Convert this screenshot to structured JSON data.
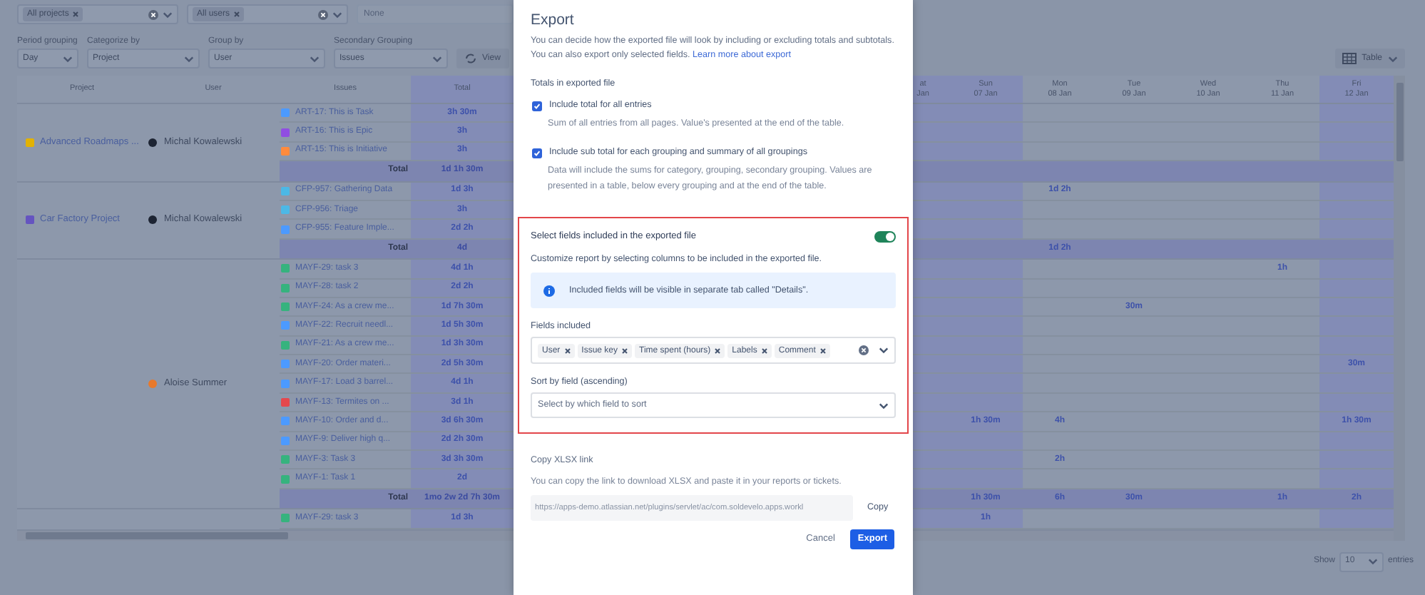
{
  "filters": {
    "projects": {
      "tags": [
        "All projects"
      ]
    },
    "users": {
      "tags": [
        "All users"
      ]
    },
    "third": {
      "placeholder": "None"
    }
  },
  "grouping": [
    {
      "label": "Period grouping",
      "value": "Day"
    },
    {
      "label": "Categorize by",
      "value": "Project"
    },
    {
      "label": "Group by",
      "value": "User"
    },
    {
      "label": "Secondary Grouping",
      "value": "Issues"
    }
  ],
  "view_button": "View",
  "table_button": "Table",
  "table": {
    "columns": [
      "Project",
      "User",
      "Issues",
      "Total"
    ],
    "day_columns": [
      {
        "day": "at",
        "date": "Jan"
      },
      {
        "day": "Sun",
        "date": "07 Jan"
      },
      {
        "day": "Mon",
        "date": "08 Jan"
      },
      {
        "day": "Tue",
        "date": "09 Jan"
      },
      {
        "day": "Wed",
        "date": "10 Jan"
      },
      {
        "day": "Thu",
        "date": "11 Jan"
      },
      {
        "day": "Fri",
        "date": "12 Jan"
      }
    ],
    "groups": [
      {
        "project": {
          "name": "Advanced Roadmaps ...",
          "color": "#e2b203"
        },
        "user": {
          "name": "Michal Kowalewski",
          "color": "#1d2433"
        },
        "rows": [
          {
            "issue": "ART-17: This is Task",
            "color": "#4c9aff",
            "total": "3h 30m"
          },
          {
            "issue": "ART-16: This is Epic",
            "color": "#904ee2",
            "total": "3h"
          },
          {
            "issue": "ART-15: This is Initiative",
            "color": "#ff8b3d",
            "total": "3h"
          }
        ],
        "summary": {
          "label": "Total",
          "total": "1d 1h 30m"
        }
      },
      {
        "project": {
          "name": "Car Factory Project",
          "color": "#6554c0"
        },
        "user": {
          "name": "Michal Kowalewski",
          "color": "#1d2433"
        },
        "rows": [
          {
            "issue": "CFP-957: Gathering Data",
            "color": "#4cb8e6",
            "total": "1d 3h",
            "days": [
              {
                "kind": "empty"
              },
              {
                "kind": "empty"
              },
              {
                "kind": "time",
                "text": "1d 2h"
              },
              {
                "kind": "empty"
              },
              {
                "kind": "empty"
              },
              {
                "kind": "empty"
              },
              {
                "kind": "empty"
              }
            ]
          },
          {
            "issue": "CFP-956: Triage",
            "color": "#4cb8e6",
            "total": "3h"
          },
          {
            "issue": "CFP-955: Feature Imple...",
            "color": "#4c9aff",
            "total": "2d 2h"
          }
        ],
        "summary": {
          "label": "Total",
          "total": "4d",
          "days": [
            {
              "kind": "empty"
            },
            {
              "kind": "empty"
            },
            {
              "kind": "time",
              "text": "1d 2h"
            },
            {
              "kind": "empty"
            },
            {
              "kind": "empty"
            },
            {
              "kind": "empty"
            },
            {
              "kind": "empty"
            }
          ]
        }
      },
      {
        "user": {
          "name": "Aloise Summer",
          "color": "#e8792b"
        },
        "rows": [
          {
            "issue": "MAYF-29: task 3",
            "color": "#36b37e",
            "total": "4d 1h",
            "days": [
              {
                "kind": "empty"
              },
              {
                "kind": "empty"
              },
              {
                "kind": "empty"
              },
              {
                "kind": "empty"
              },
              {
                "kind": "empty"
              },
              {
                "kind": "time",
                "text": "1h"
              },
              {
                "kind": "empty"
              }
            ]
          },
          {
            "issue": "MAYF-28: task 2",
            "color": "#36b37e",
            "total": "2d 2h"
          },
          {
            "issue": "MAYF-24: As a crew me...",
            "color": "#36b37e",
            "total": "1d 7h 30m",
            "days": [
              {
                "kind": "empty"
              },
              {
                "kind": "empty"
              },
              {
                "kind": "empty"
              },
              {
                "kind": "time",
                "text": "30m"
              },
              {
                "kind": "empty"
              },
              {
                "kind": "empty"
              },
              {
                "kind": "empty"
              }
            ]
          },
          {
            "issue": "MAYF-22: Recruit needl...",
            "color": "#4c9aff",
            "total": "1d 5h 30m"
          },
          {
            "issue": "MAYF-21: As a crew me...",
            "color": "#36b37e",
            "total": "1d 3h 30m"
          },
          {
            "issue": "MAYF-20: Order materi...",
            "color": "#4c9aff",
            "total": "2d 5h 30m",
            "days": [
              {
                "kind": "empty"
              },
              {
                "kind": "empty"
              },
              {
                "kind": "empty"
              },
              {
                "kind": "empty"
              },
              {
                "kind": "empty"
              },
              {
                "kind": "empty"
              },
              {
                "kind": "time",
                "text": "30m"
              }
            ]
          },
          {
            "issue": "MAYF-17: Load 3 barrel...",
            "color": "#4c9aff",
            "total": "4d 1h"
          },
          {
            "issue": "MAYF-13: Termites on ...",
            "color": "#e5484d",
            "total": "3d 1h"
          },
          {
            "issue": "MAYF-10: Order and d...",
            "color": "#4c9aff",
            "total": "3d 6h 30m",
            "days": [
              {
                "kind": "empty"
              },
              {
                "kind": "time",
                "text": "1h 30m"
              },
              {
                "kind": "time",
                "text": "4h"
              },
              {
                "kind": "empty"
              },
              {
                "kind": "empty"
              },
              {
                "kind": "empty"
              },
              {
                "kind": "time",
                "text": "1h 30m"
              }
            ]
          },
          {
            "issue": "MAYF-9: Deliver high q...",
            "color": "#4c9aff",
            "total": "2d 2h 30m"
          },
          {
            "issue": "MAYF-3: Task 3",
            "color": "#36b37e",
            "total": "3d 3h 30m",
            "days": [
              {
                "kind": "empty"
              },
              {
                "kind": "empty"
              },
              {
                "kind": "time",
                "text": "2h"
              },
              {
                "kind": "empty"
              },
              {
                "kind": "empty"
              },
              {
                "kind": "empty"
              },
              {
                "kind": "empty"
              }
            ]
          },
          {
            "issue": "MAYF-1: Task 1",
            "color": "#36b37e",
            "total": "2d"
          }
        ],
        "summary": {
          "label": "Total",
          "total": "1mo 2w 2d 7h 30m",
          "days": [
            {
              "kind": "empty"
            },
            {
              "kind": "time",
              "text": "1h 30m"
            },
            {
              "kind": "time",
              "text": "6h"
            },
            {
              "kind": "time",
              "text": "30m"
            },
            {
              "kind": "empty"
            },
            {
              "kind": "time",
              "text": "1h"
            },
            {
              "kind": "time",
              "text": "2h"
            }
          ]
        }
      },
      {
        "rows": [
          {
            "issue": "MAYF-29: task 3",
            "color": "#36b37e",
            "total": "1d 3h",
            "days": [
              {
                "kind": "empty"
              },
              {
                "kind": "time",
                "text": "1h"
              },
              {
                "kind": "empty"
              },
              {
                "kind": "empty"
              },
              {
                "kind": "empty"
              },
              {
                "kind": "empty"
              },
              {
                "kind": "empty"
              }
            ]
          }
        ]
      }
    ]
  },
  "pagination": {
    "show_label": "Show",
    "page_size": "10",
    "entries_label": "entries"
  },
  "export_dialog": {
    "title": "Export",
    "description": "You can decide how the exported file will look by including or excluding totals and subtotals. You can also export only selected fields.",
    "learn_more_link": "Learn more about export",
    "totals_heading": "Totals in exported file",
    "options": [
      {
        "label": "Include total for all entries",
        "description": "Sum of all entries from all pages. Value's presented at the end of the table.",
        "checked": true
      },
      {
        "label": "Include sub total for each grouping and summary of all groupings",
        "description": "Data will include the sums for category, grouping, secondary grouping. Values are presented in a table, below every grouping and at the end of the table.",
        "checked": true
      }
    ],
    "fields_section": {
      "title": "Select fields included in the exported file",
      "on": true,
      "highlighted": true,
      "description": "Customize report by selecting columns to be included in the exported file.",
      "info": "Included fields will be visible in separate tab called \"Details\".",
      "fields_label": "Fields included",
      "fields": [
        "User",
        "Issue key",
        "Time spent (hours)",
        "Labels",
        "Comment"
      ],
      "sort_label": "Sort by field (ascending)",
      "sort_placeholder": "Select by which field to sort"
    },
    "copy_link": {
      "title": "Copy XLSX link",
      "description": "You can copy the link to download XLSX and paste it in your reports or tickets.",
      "url": "https://apps-demo.atlassian.net/plugins/servlet/ac/com.soldevelo.apps.workl",
      "copy_button": "Copy"
    },
    "buttons": [
      {
        "label": "Cancel",
        "kind": "subtle"
      },
      {
        "label": "Export",
        "kind": "primary"
      }
    ]
  }
}
